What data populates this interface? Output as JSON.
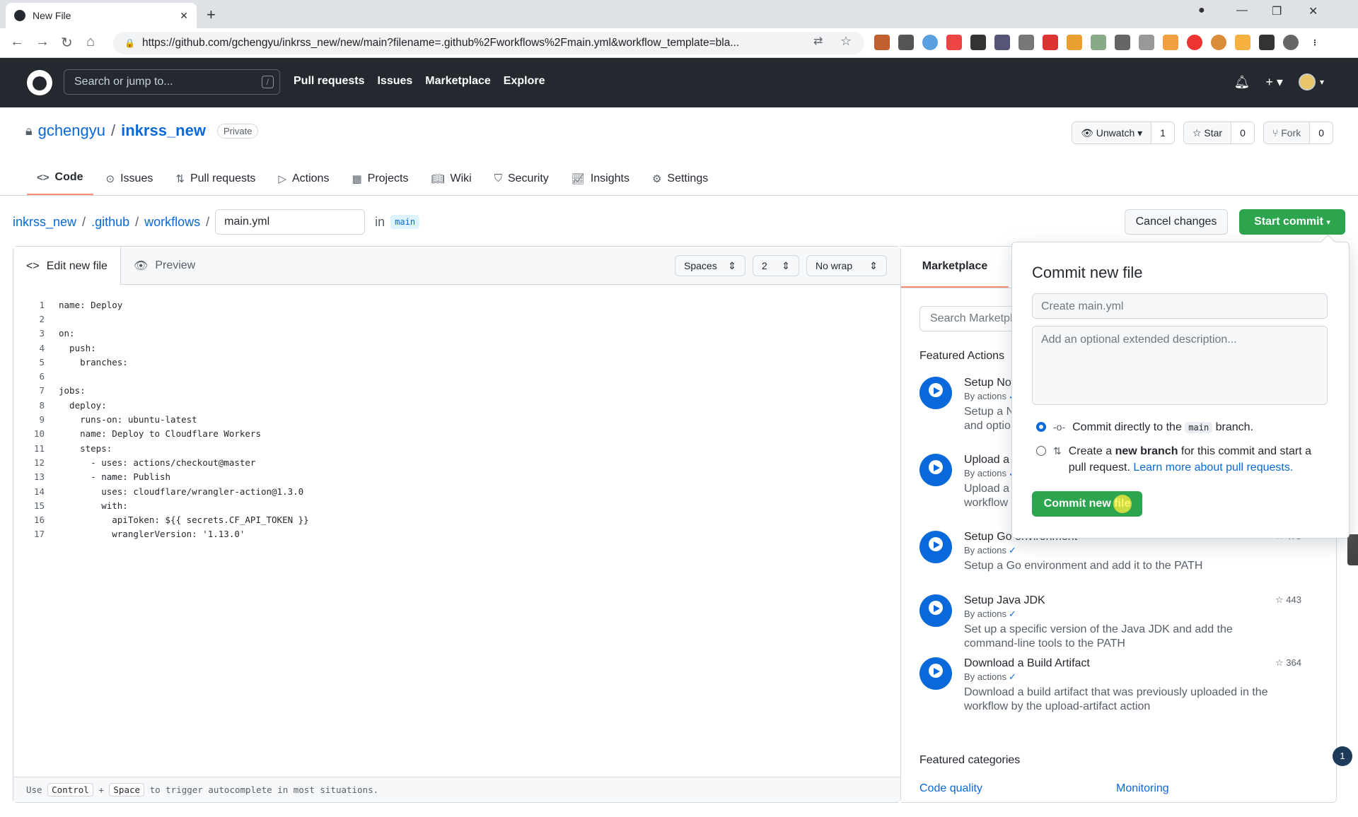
{
  "browser": {
    "tab_title": "New File",
    "url": "https://github.com/gchengyu/inkrss_new/new/main?filename=.github%2Fworkflows%2Fmain.yml&workflow_template=bla..."
  },
  "header": {
    "search_placeholder": "Search or jump to...",
    "search_shortcut": "/",
    "nav": [
      "Pull requests",
      "Issues",
      "Marketplace",
      "Explore"
    ]
  },
  "repo": {
    "owner": "gchengyu",
    "name": "inkrss_new",
    "visibility": "Private",
    "unwatch_label": "Unwatch",
    "unwatch_count": "1",
    "star_label": "Star",
    "star_count": "0",
    "fork_label": "Fork",
    "fork_count": "0"
  },
  "tabs": [
    "Code",
    "Issues",
    "Pull requests",
    "Actions",
    "Projects",
    "Wiki",
    "Security",
    "Insights",
    "Settings"
  ],
  "breadcrumb": {
    "root": "inkrss_new",
    "dir1": ".github",
    "dir2": "workflows",
    "filename": "main.yml",
    "in_label": "in",
    "branch": "main"
  },
  "buttons": {
    "cancel": "Cancel changes",
    "start_commit": "Start commit"
  },
  "editor": {
    "tab_edit": "Edit new file",
    "tab_preview": "Preview",
    "indent_mode": "Spaces",
    "indent_size": "2",
    "wrap_mode": "No wrap",
    "lines": [
      "name: Deploy",
      "",
      "on:",
      "  push:",
      "    branches:",
      "",
      "jobs:",
      "  deploy:",
      "    runs-on: ubuntu-latest",
      "    name: Deploy to Cloudflare Workers",
      "    steps:",
      "      - uses: actions/checkout@master",
      "      - name: Publish",
      "        uses: cloudflare/wrangler-action@1.3.0",
      "        with:",
      "          apiToken: ${{ secrets.CF_API_TOKEN }}",
      "          wranglerVersion: '1.13.0'"
    ],
    "footer_use": "Use",
    "footer_key1": "Control",
    "footer_plus": "+",
    "footer_key2": "Space",
    "footer_rest": "to trigger autocomplete in most situations."
  },
  "marketplace": {
    "tab": "Marketplace",
    "search_placeholder": "Search Marketpla",
    "featured_actions": "Featured Actions",
    "actions": [
      {
        "title": "Setup No",
        "by": "By actions",
        "desc": "Setup a N\nand optio",
        "stars": ""
      },
      {
        "title": "Upload a",
        "by": "By actions",
        "desc": "Upload a\nworkflow",
        "stars": ""
      },
      {
        "title": "Setup Go environment",
        "by": "By actions",
        "desc": "Setup a Go environment and add it to the PATH",
        "stars": "475"
      },
      {
        "title": "Setup Java JDK",
        "by": "By actions",
        "desc": "Set up a specific version of the Java JDK and add the command-line tools to the PATH",
        "stars": "443"
      },
      {
        "title": "Download a Build Artifact",
        "by": "By actions",
        "desc": "Download a build artifact that was previously uploaded in the workflow by the upload-artifact action",
        "stars": "364"
      }
    ],
    "featured_categories": "Featured categories",
    "categories": [
      "Code quality",
      "Monitoring"
    ]
  },
  "commit_popover": {
    "title": "Commit new file",
    "summary_placeholder": "Create main.yml",
    "description_placeholder": "Add an optional extended description...",
    "option1_prefix": "Commit directly to the",
    "option1_branch": "main",
    "option1_suffix": "branch.",
    "option2_prefix": "Create a",
    "option2_bold": "new branch",
    "option2_suffix": "for this commit and start a pull request.",
    "option2_link": "Learn more about pull requests.",
    "submit": "Commit new file"
  },
  "notification_count": "1"
}
